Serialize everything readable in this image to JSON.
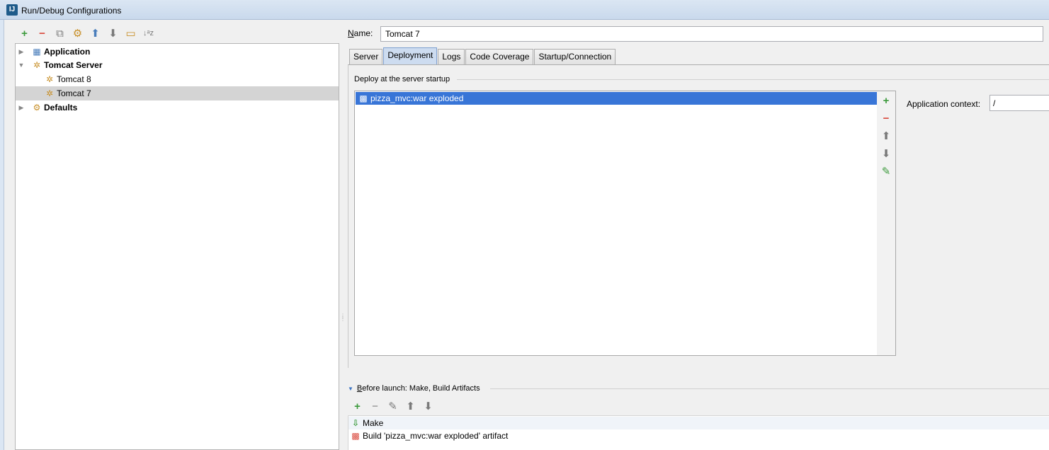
{
  "window": {
    "title": "Run/Debug Configurations",
    "app_icon_text": "IJ"
  },
  "toolbar_left": {
    "add": "+",
    "remove": "−",
    "copy": "⧉",
    "edit_defaults": "⚙",
    "move_up": "⬆",
    "move_down": "⬇",
    "folder": "▭",
    "sort": "↓ᵃz"
  },
  "tree": {
    "items": [
      {
        "label": "Application",
        "arrow": "▶",
        "icon": "▦"
      },
      {
        "label": "Tomcat Server",
        "arrow": "▼",
        "icon": "✲"
      },
      {
        "label": "Tomcat 8",
        "icon": "✲"
      },
      {
        "label": "Tomcat 7",
        "icon": "✲"
      },
      {
        "label": "Defaults",
        "arrow": "▶",
        "icon": "⚙"
      }
    ],
    "selected": "Tomcat 7"
  },
  "form": {
    "name_label_mnemonic": "N",
    "name_label_rest": "ame:",
    "name_value": "Tomcat 7"
  },
  "tabs": [
    {
      "label": "Server"
    },
    {
      "label": "Deployment"
    },
    {
      "label": "Logs"
    },
    {
      "label": "Code Coverage"
    },
    {
      "label": "Startup/Connection"
    }
  ],
  "active_tab": "Deployment",
  "deployment": {
    "group_title": "Deploy at the server startup",
    "artifacts": [
      {
        "label": "pizza_mvc:war exploded",
        "icon": "▩"
      }
    ],
    "side_buttons": {
      "add": "+",
      "remove": "−",
      "up": "⬆",
      "down": "⬇",
      "edit": "✎"
    },
    "context_label": "Application context:",
    "context_value": "/"
  },
  "before_launch": {
    "toggle": "▼",
    "mnemonic": "B",
    "title_rest": "efore launch: Make, Build Artifacts",
    "toolbar": {
      "add": "+",
      "remove": "−",
      "edit": "✎",
      "up": "⬆",
      "down": "⬇"
    },
    "items": [
      {
        "label": "Make",
        "icon": "⇩"
      },
      {
        "label": "Build 'pizza_mvc:war exploded' artifact",
        "icon": "▩"
      }
    ]
  },
  "colors": {
    "selection_blue": "#3875d7",
    "tree_selected_gray": "#d4d4d4",
    "active_tab": "#cddcf0",
    "add_green": "#3c9a3c",
    "remove_red": "#d9473b"
  }
}
